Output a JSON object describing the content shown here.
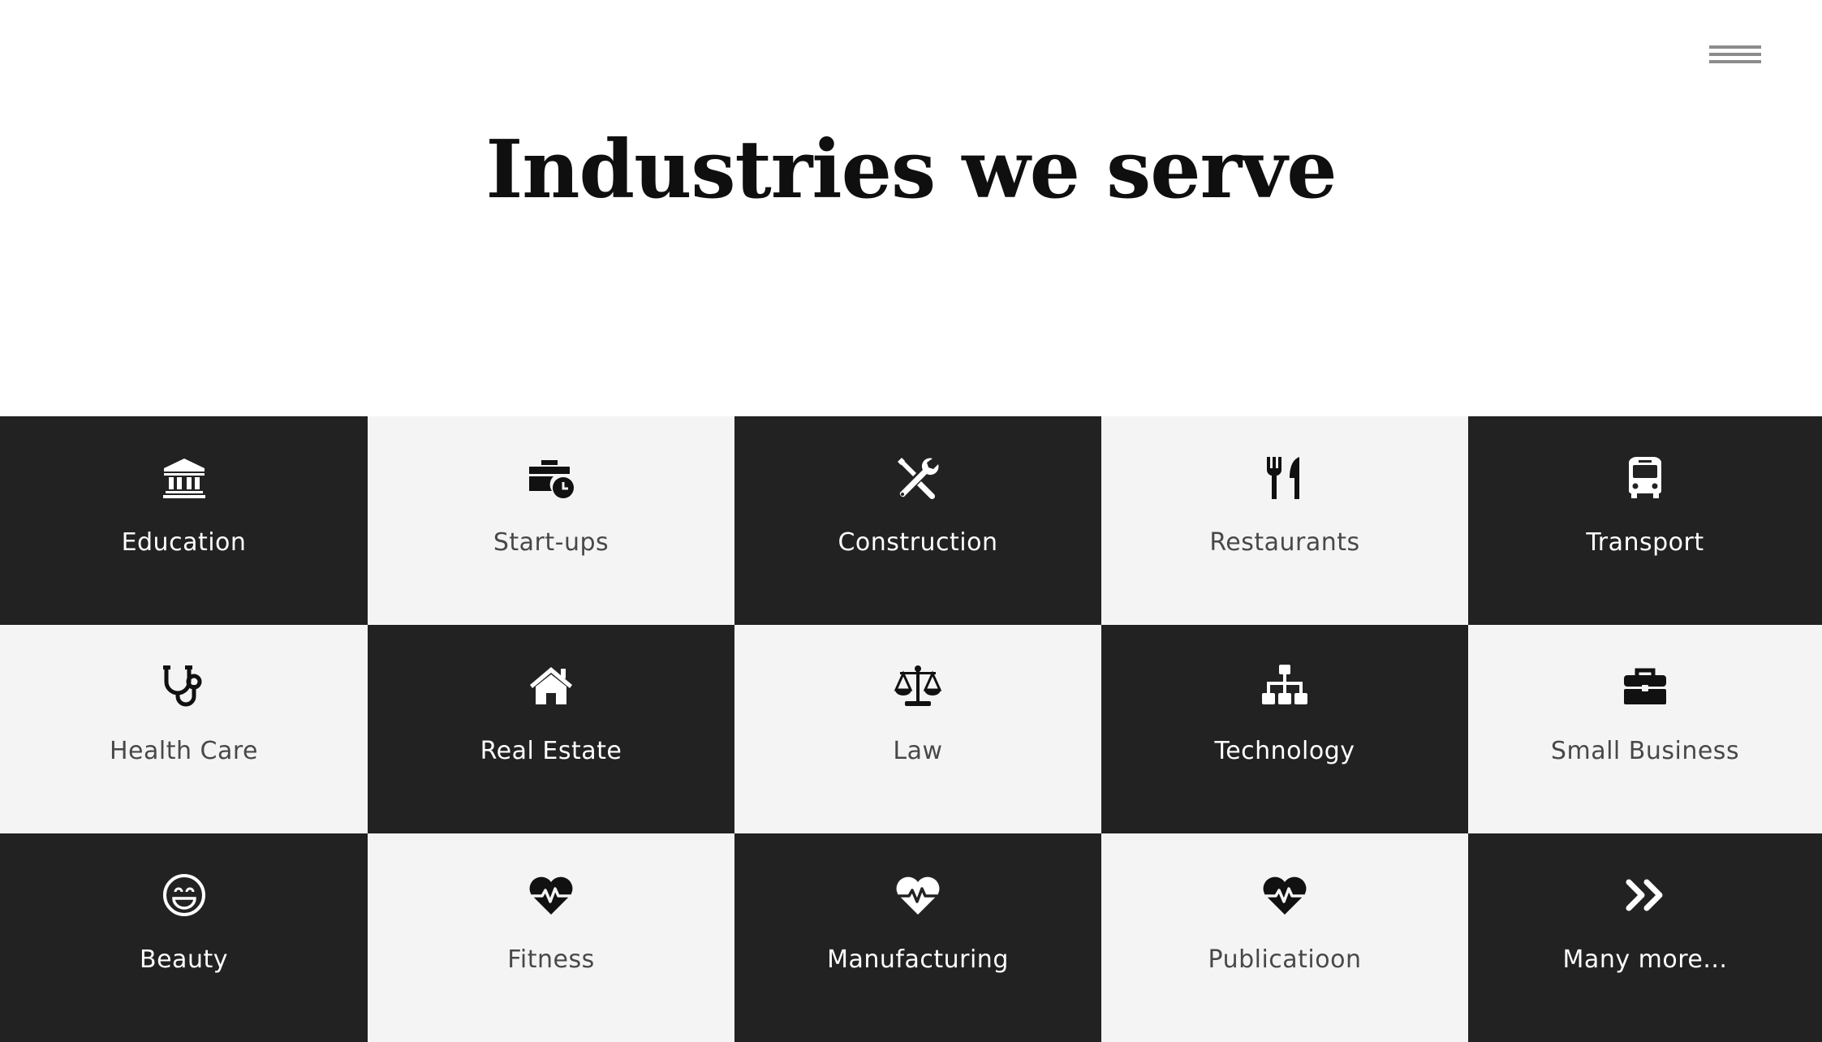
{
  "page": {
    "heading": "Industries we serve"
  },
  "menu": {
    "icon": "hamburger-menu-icon"
  },
  "colors": {
    "dark_tile": "#222222",
    "light_tile": "#f4f4f4",
    "dark_text": "#ffffff",
    "light_text": "#484848",
    "menu_icon": "#8c8c8c"
  },
  "industries": [
    {
      "label": "Education",
      "icon": "university-icon",
      "theme": "dark"
    },
    {
      "label": "Start-ups",
      "icon": "business-time-icon",
      "theme": "light"
    },
    {
      "label": "Construction",
      "icon": "tools-icon",
      "theme": "dark"
    },
    {
      "label": "Restaurants",
      "icon": "utensils-icon",
      "theme": "light"
    },
    {
      "label": "Transport",
      "icon": "bus-icon",
      "theme": "dark"
    },
    {
      "label": "Health Care",
      "icon": "stethoscope-icon",
      "theme": "light"
    },
    {
      "label": "Real Estate",
      "icon": "home-icon",
      "theme": "dark"
    },
    {
      "label": "Law",
      "icon": "balance-scale-icon",
      "theme": "light"
    },
    {
      "label": "Technology",
      "icon": "sitemap-icon",
      "theme": "dark"
    },
    {
      "label": "Small Business",
      "icon": "briefcase-icon",
      "theme": "light"
    },
    {
      "label": "Beauty",
      "icon": "smile-icon",
      "theme": "dark"
    },
    {
      "label": "Fitness",
      "icon": "heartbeat-icon",
      "theme": "light"
    },
    {
      "label": "Manufacturing",
      "icon": "heartbeat-icon",
      "theme": "dark"
    },
    {
      "label": "Publicatioon",
      "icon": "heartbeat-icon",
      "theme": "light"
    },
    {
      "label": "Many more...",
      "icon": "angle-double-right-icon",
      "theme": "dark"
    }
  ]
}
